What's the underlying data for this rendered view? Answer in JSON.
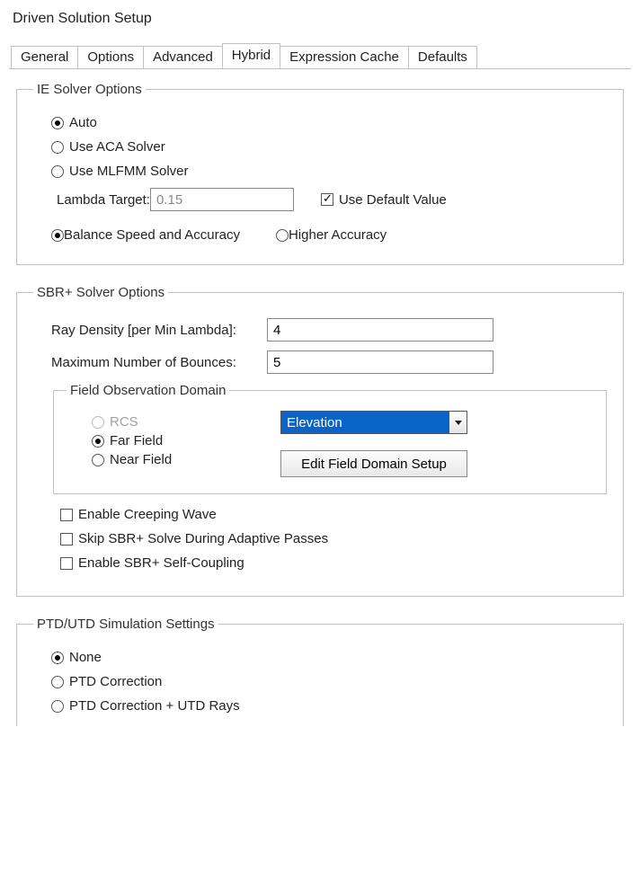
{
  "window_title": "Driven Solution Setup",
  "tabs": {
    "items": [
      {
        "label": "General"
      },
      {
        "label": "Options"
      },
      {
        "label": "Advanced"
      },
      {
        "label": "Hybrid"
      },
      {
        "label": "Expression Cache"
      },
      {
        "label": "Defaults"
      }
    ],
    "active_index": 3
  },
  "ie": {
    "legend": "IE Solver Options",
    "auto": "Auto",
    "aca": "Use ACA Solver",
    "mlfmm": "Use MLFMM Solver",
    "lambda_label": "Lambda Target:",
    "lambda_value": "0.15",
    "use_default": "Use Default Value",
    "balance": "Balance Speed and Accuracy",
    "higher": "Higher Accuracy"
  },
  "sbr": {
    "legend": "SBR+ Solver Options",
    "ray_density_label": "Ray Density [per Min Lambda]:",
    "ray_density_value": "4",
    "max_bounces_label": "Maximum Number of Bounces:",
    "max_bounces_value": "5",
    "fod": {
      "legend": "Field Observation Domain",
      "rcs": "RCS",
      "far": "Far Field",
      "near": "Near Field",
      "dropdown_value": "Elevation",
      "edit_button": "Edit Field Domain Setup"
    },
    "cb_creeping": "Enable Creeping Wave",
    "cb_skip": "Skip SBR+ Solve During Adaptive Passes",
    "cb_selfcoupling": "Enable SBR+ Self-Coupling"
  },
  "ptd": {
    "legend": "PTD/UTD Simulation Settings",
    "none": "None",
    "ptd": "PTD Correction",
    "ptd_utd": "PTD Correction + UTD Rays"
  }
}
